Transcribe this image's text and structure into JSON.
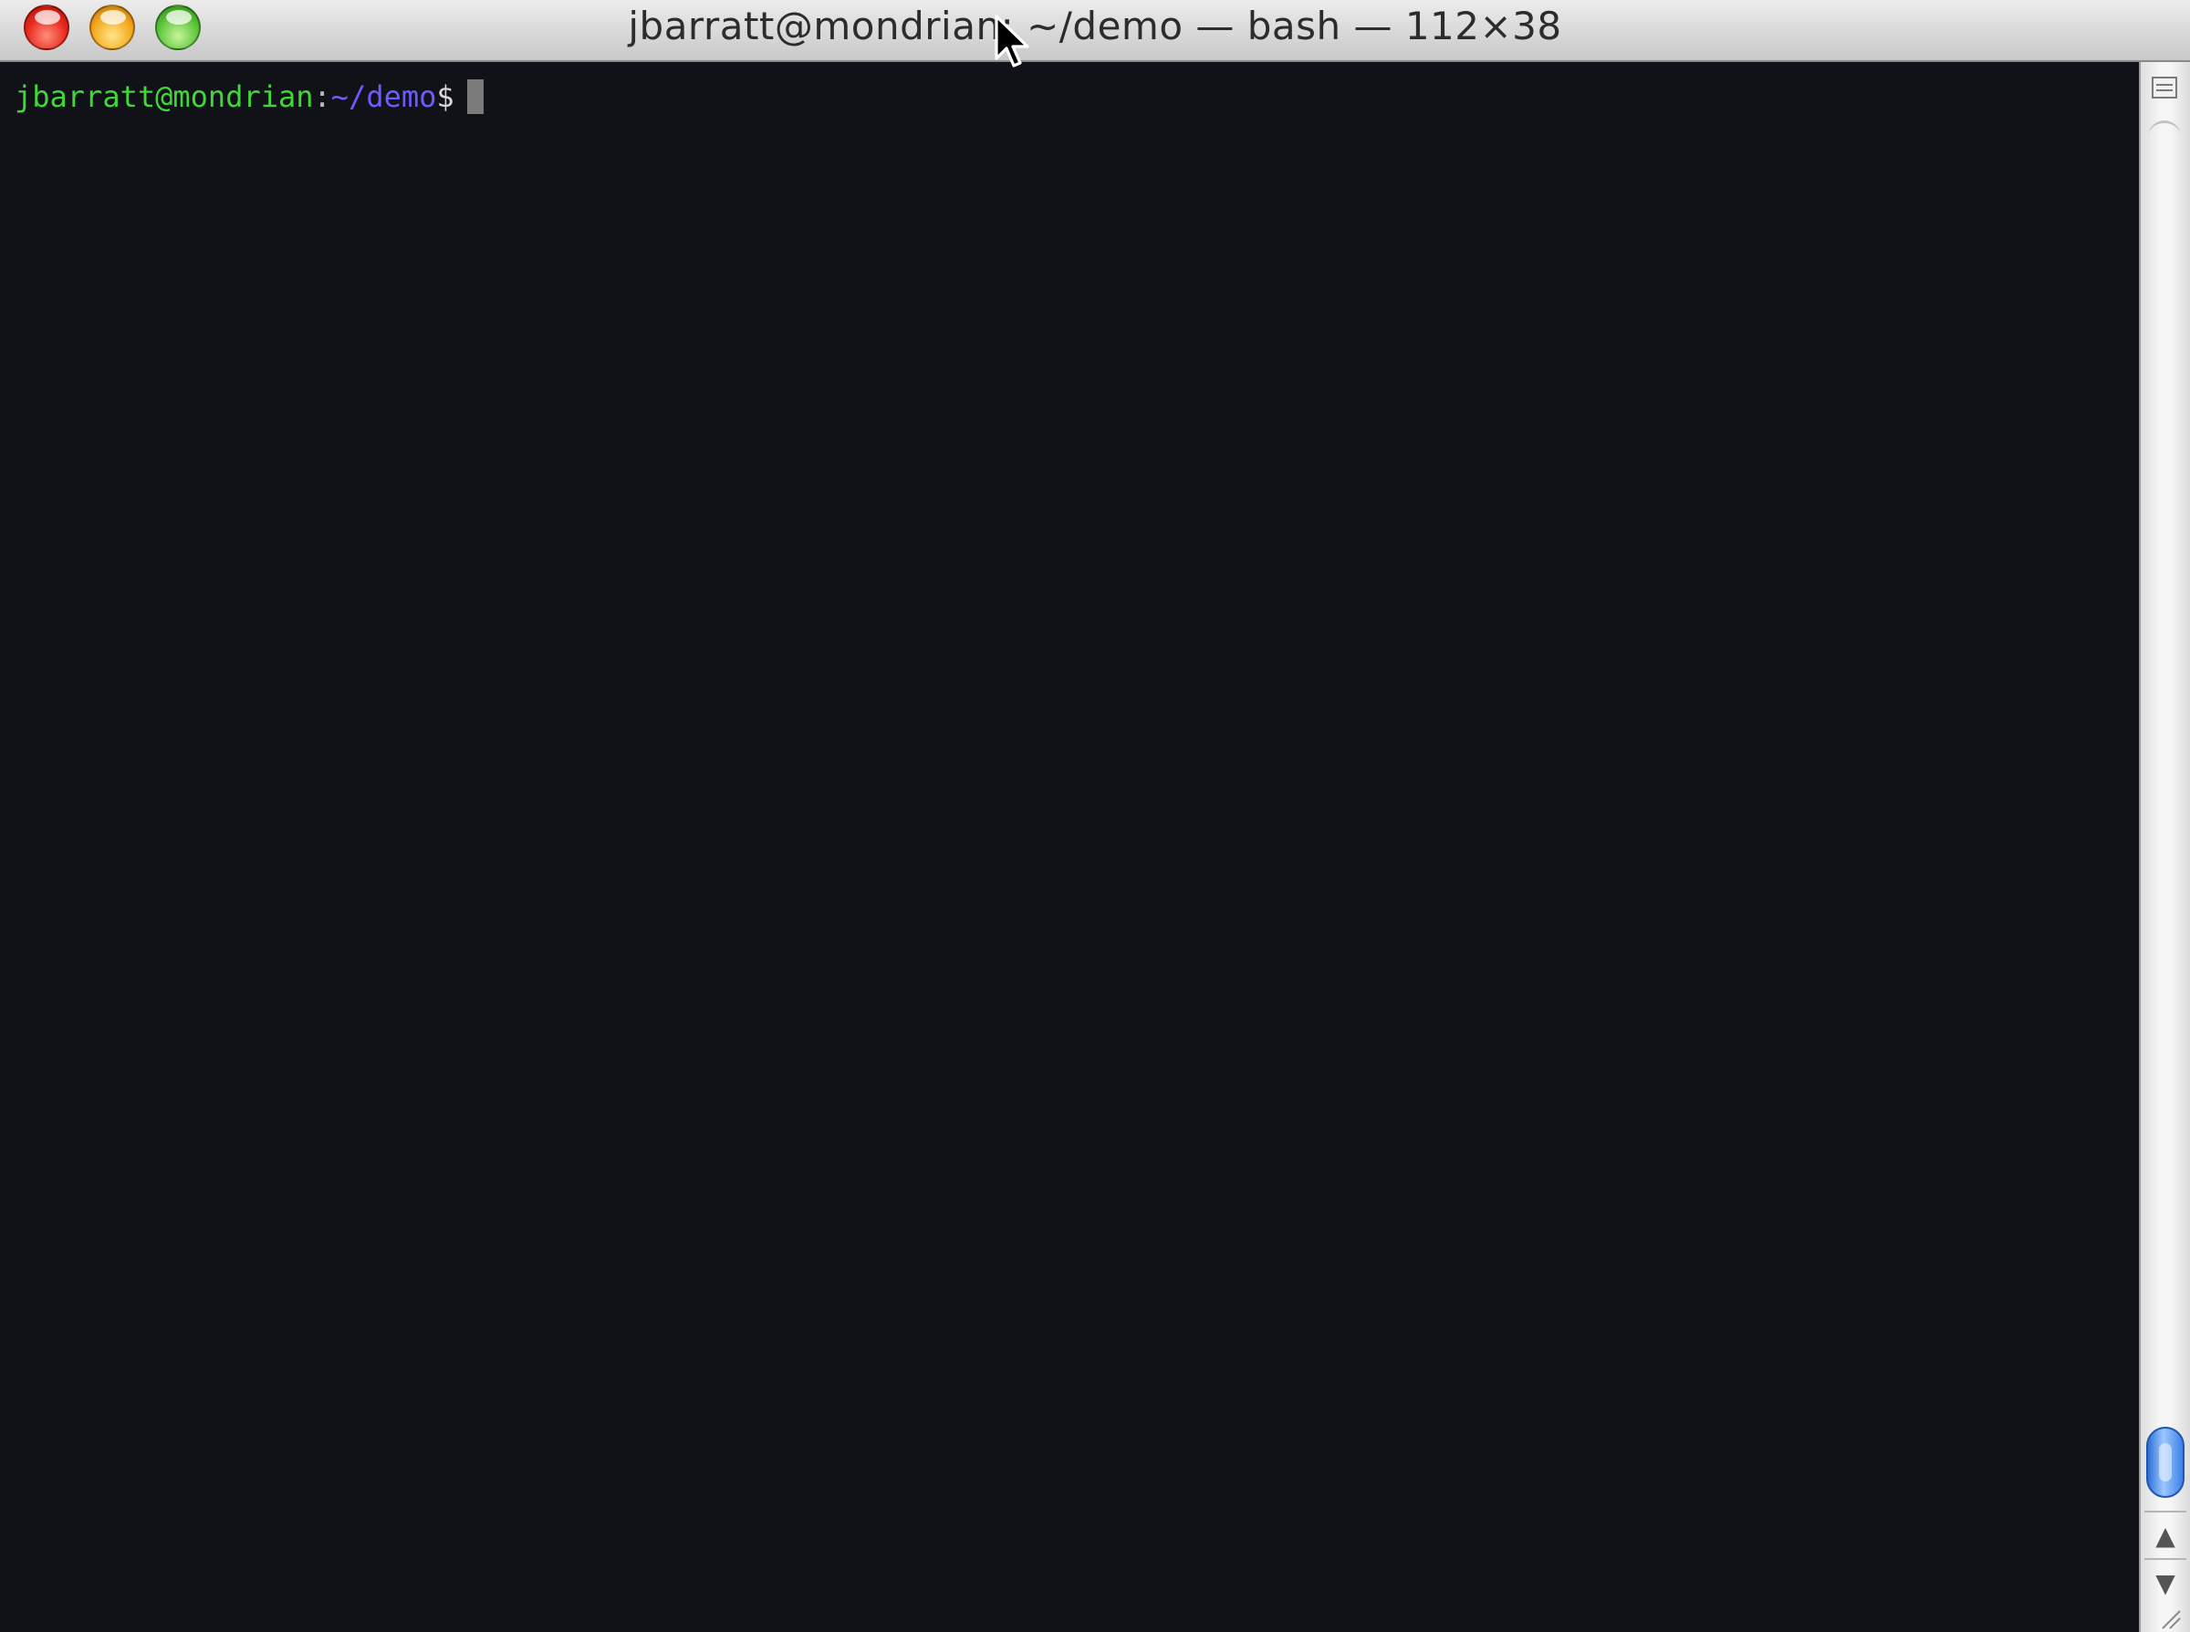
{
  "window": {
    "title": "jbarratt@mondrian: ~/demo — bash — 112×38",
    "controls": [
      "close",
      "minimize",
      "zoom"
    ]
  },
  "terminal": {
    "user_host": "jbarratt@mondrian",
    "separator": ":",
    "cwd": "~/demo",
    "prompt_symbol": "$",
    "input": ""
  },
  "scrollbar": {
    "up_arrow": "▲",
    "down_arrow": "▼",
    "scroll_position": 1.0
  },
  "colors": {
    "background": "#111217",
    "user_host": "#41d63a",
    "path": "#6b5cff",
    "thumb": "#3a80e8"
  },
  "icons": {
    "close": "close-icon",
    "minimize": "minimize-icon",
    "zoom": "zoom-icon",
    "split": "split-pane-icon",
    "cursor": "mouse-pointer-icon"
  }
}
